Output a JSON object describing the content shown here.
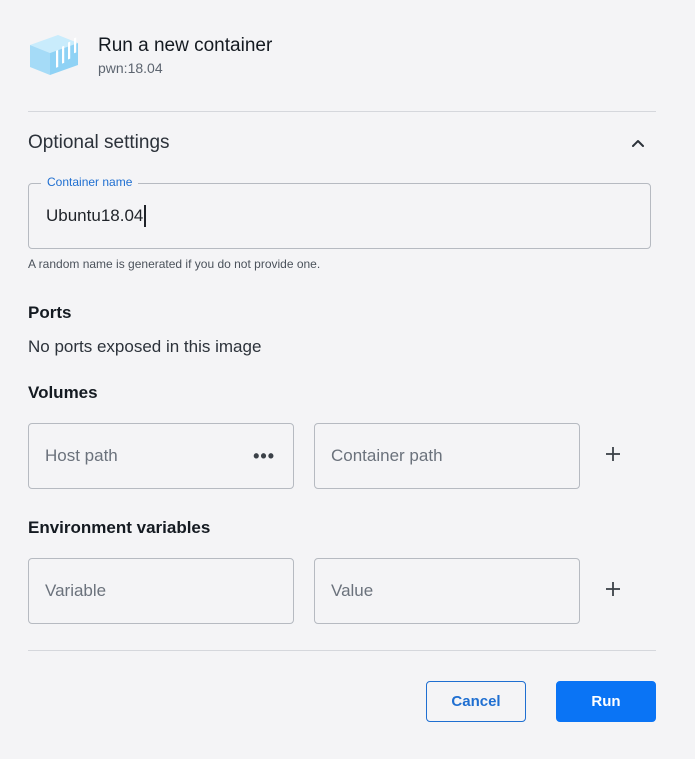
{
  "header": {
    "title": "Run a new container",
    "subtitle": "pwn:18.04",
    "icon": "container-icon",
    "icon_color": "#a5dbf7"
  },
  "optional_settings": {
    "title": "Optional settings",
    "expanded": true
  },
  "container_name": {
    "label": "Container name",
    "value": "Ubuntu18.04",
    "helper": "A random name is generated if you do not provide one."
  },
  "ports": {
    "label": "Ports",
    "text": "No ports exposed in this image"
  },
  "volumes": {
    "label": "Volumes",
    "host_path_placeholder": "Host path",
    "browse_label": "•••",
    "container_path_placeholder": "Container path"
  },
  "env": {
    "label": "Environment variables",
    "variable_placeholder": "Variable",
    "value_placeholder": "Value"
  },
  "buttons": {
    "cancel": "Cancel",
    "run": "Run"
  },
  "colors": {
    "accent": "#0a74f5",
    "label_accent": "#1f6fd1",
    "background": "#f4f4f6"
  }
}
